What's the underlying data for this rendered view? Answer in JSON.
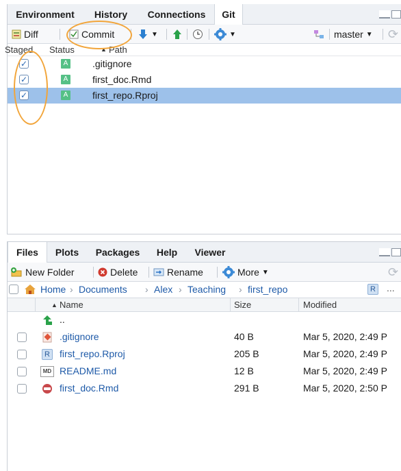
{
  "git_pane": {
    "tabs": [
      "Environment",
      "History",
      "Connections",
      "Git"
    ],
    "active_tab": "Git",
    "toolbar": {
      "diff_label": "Diff",
      "commit_label": "Commit",
      "branch_label": "master"
    },
    "columns": {
      "staged": "Staged",
      "status": "Status",
      "path": "Path"
    },
    "rows": [
      {
        "staged": true,
        "status": "A",
        "path": ".gitignore",
        "selected": false
      },
      {
        "staged": true,
        "status": "A",
        "path": "first_doc.Rmd",
        "selected": false
      },
      {
        "staged": true,
        "status": "A",
        "path": "first_repo.Rproj",
        "selected": true
      }
    ]
  },
  "files_pane": {
    "tabs": [
      "Files",
      "Plots",
      "Packages",
      "Help",
      "Viewer"
    ],
    "active_tab": "Files",
    "toolbar": {
      "new_folder_label": "New Folder",
      "delete_label": "Delete",
      "rename_label": "Rename",
      "more_label": "More"
    },
    "breadcrumb": [
      "Home",
      "Documents",
      "Alex",
      "Teaching",
      "first_repo"
    ],
    "more_crumb": "...",
    "columns": {
      "name": "Name",
      "size": "Size",
      "modified": "Modified"
    },
    "parent_dir": "..",
    "files": [
      {
        "name": ".gitignore",
        "size": "40 B",
        "modified": "Mar 5, 2020, 2:49 P",
        "icon": "git-file-icon"
      },
      {
        "name": "first_repo.Rproj",
        "size": "205 B",
        "modified": "Mar 5, 2020, 2:49 P",
        "icon": "rproj-file-icon"
      },
      {
        "name": "README.md",
        "size": "12 B",
        "modified": "Mar 5, 2020, 2:49 P",
        "icon": "markdown-file-icon"
      },
      {
        "name": "first_doc.Rmd",
        "size": "291 B",
        "modified": "Mar 5, 2020, 2:50 P",
        "icon": "rmd-file-icon"
      }
    ]
  },
  "colors": {
    "selected_row": "#9dc1ea",
    "status_added": "#55c086",
    "link": "#1e5aa8",
    "annotation": "#f2a53a"
  }
}
